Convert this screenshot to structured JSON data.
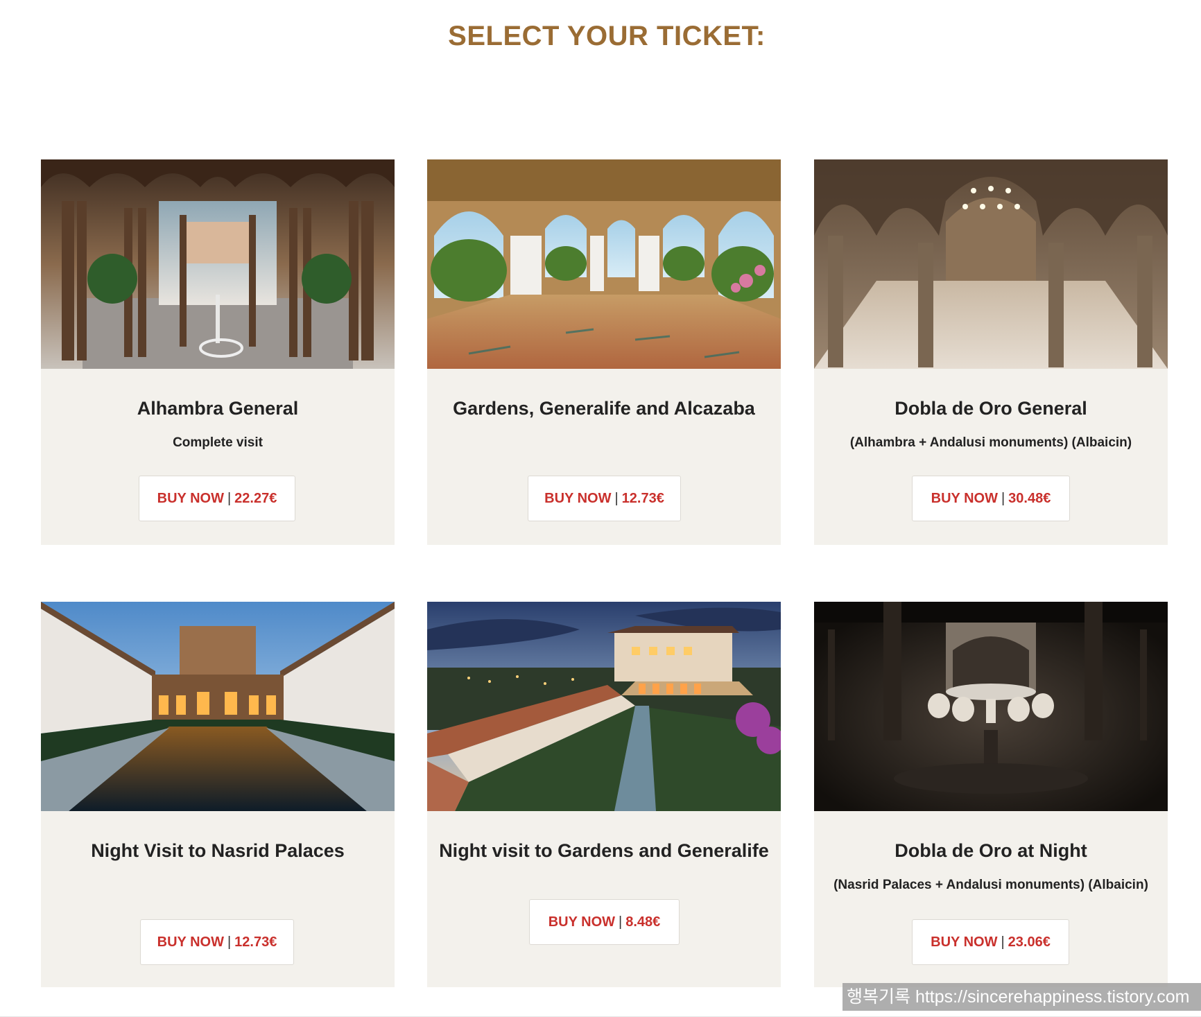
{
  "page": {
    "title": "SELECT YOUR TICKET:"
  },
  "tickets": [
    {
      "title": "Alhambra General",
      "subtitle": "Complete visit",
      "buy_label": "BUY NOW",
      "price": "22.27€"
    },
    {
      "title": "Gardens, Generalife and Alcazaba",
      "subtitle": "",
      "buy_label": "BUY NOW",
      "price": "12.73€"
    },
    {
      "title": "Dobla de Oro General",
      "subtitle": "(Alhambra + Andalusi monuments) (Albaicin)",
      "buy_label": "BUY NOW",
      "price": "30.48€"
    },
    {
      "title": "Night Visit to Nasrid Palaces",
      "subtitle": "",
      "buy_label": "BUY NOW",
      "price": "12.73€"
    },
    {
      "title": "Night visit to Gardens and Generalife",
      "subtitle": "",
      "buy_label": "BUY NOW",
      "price": "8.48€"
    },
    {
      "title": "Dobla de Oro at Night",
      "subtitle": "(Nasrid Palaces + Andalusi monuments) (Albaicin)",
      "buy_label": "BUY NOW",
      "price": "23.06€"
    }
  ],
  "watermark": {
    "text": "행복기록 https://sincerehappiness.tistory.com"
  },
  "colors": {
    "title": "#9a6c34",
    "card_bg": "#f3f1ec",
    "button_text": "#c9302c"
  }
}
